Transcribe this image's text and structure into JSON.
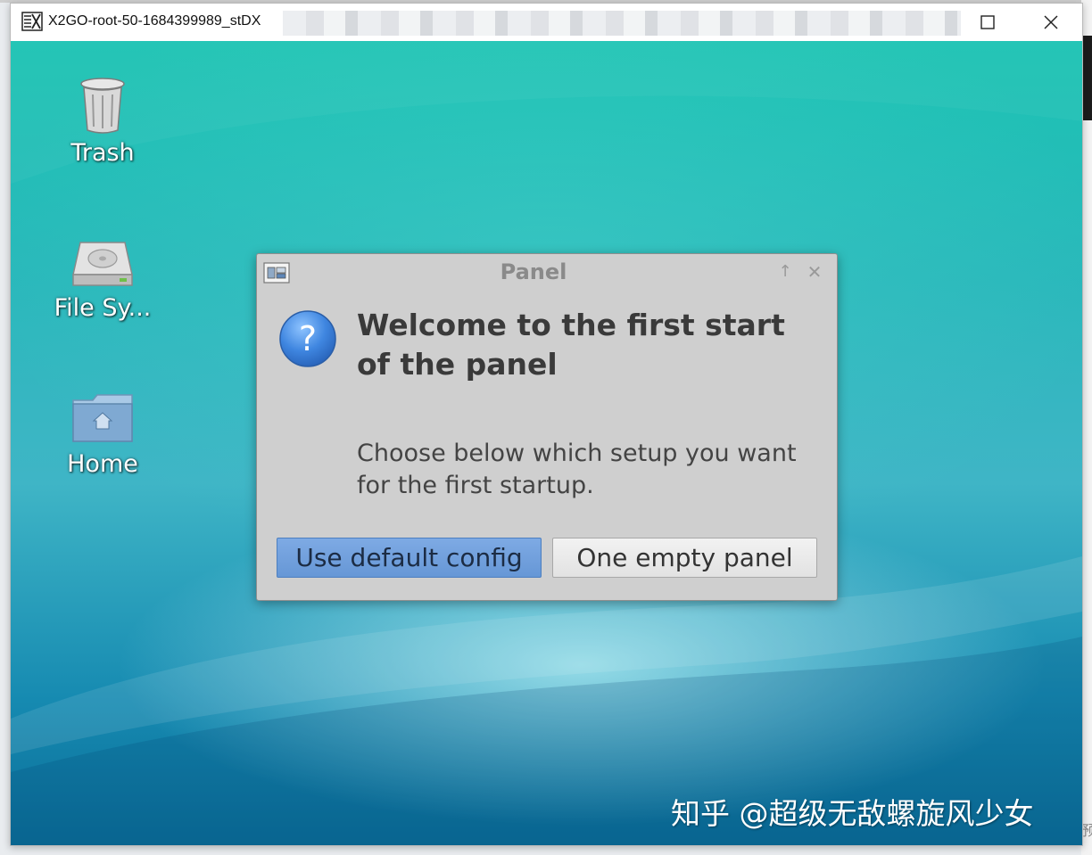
{
  "window": {
    "title": "X2GO-root-50-1684399989_stDX",
    "buttons": [
      "maximize",
      "close"
    ]
  },
  "desktop": {
    "icons": [
      {
        "label": "Trash",
        "icon": "trash-icon"
      },
      {
        "label": "File Sy...",
        "icon": "drive-icon"
      },
      {
        "label": "Home",
        "icon": "home-folder-icon"
      }
    ]
  },
  "dialog": {
    "title": "Panel",
    "heading": "Welcome to the first start of the panel",
    "message": "Choose below which setup you want for the first startup.",
    "primary_button": "Use default config",
    "secondary_button": "One empty panel",
    "icon": "question-icon"
  },
  "watermark": "知乎 @超级无敌螺旋风少女",
  "background_glyph": "预",
  "colors": {
    "desktop_top": "#1cc3b3",
    "desktop_bottom": "#0b6e98",
    "dialog_bg": "#cfcfcf",
    "primary_button": "#6f9ddb"
  }
}
